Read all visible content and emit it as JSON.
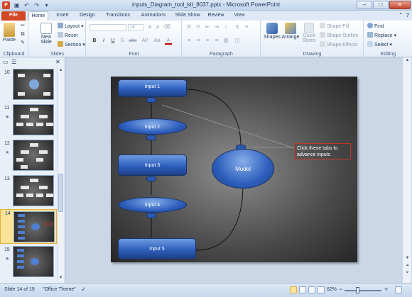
{
  "window": {
    "title": "inputs_Diagram_tool_kit_8037.pptx - Microsoft PowerPoint",
    "app_icon": "P"
  },
  "tabs": [
    "File",
    "Home",
    "Insert",
    "Design",
    "Transitions",
    "Animations",
    "Slide Show",
    "Review",
    "View"
  ],
  "ribbon": {
    "clipboard": {
      "paste": "Paste",
      "label": "Clipboard"
    },
    "slides": {
      "new_slide": "New",
      "new_slide2": "Slide",
      "layout": "Layout",
      "reset": "Reset",
      "section": "Section",
      "label": "Slides"
    },
    "font": {
      "size": "18",
      "label": "Font",
      "bold": "B",
      "italic": "I",
      "underline": "U",
      "strike": "S",
      "abc": "abc",
      "av": "AV",
      "aa": "Aa",
      "a": "A"
    },
    "paragraph": {
      "label": "Paragraph"
    },
    "drawing": {
      "shapes": "Shapes",
      "arrange": "Arrange",
      "quick_styles": "Quick",
      "quick_styles2": "Styles",
      "shape_fill": "Shape Fill",
      "shape_outline": "Shape Outline",
      "shape_effects": "Shape Effects",
      "label": "Drawing"
    },
    "editing": {
      "find": "Find",
      "replace": "Replace",
      "select": "Select",
      "label": "Editing"
    }
  },
  "slides_panel": {
    "items": [
      {
        "num": "10"
      },
      {
        "num": "11"
      },
      {
        "num": "12"
      },
      {
        "num": "13"
      },
      {
        "num": "14"
      },
      {
        "num": "15"
      }
    ]
  },
  "slide": {
    "inputs": [
      "Input 1",
      "Input 2",
      "Input 3",
      "Input 4",
      "Input 5"
    ],
    "model": "Model",
    "callout": "Click these tabs to advance inputs"
  },
  "status": {
    "slide_info": "Slide 14 of 19",
    "theme": "\"Office Theme\"",
    "zoom": "62%",
    "zoom_minus": "−",
    "zoom_plus": "+"
  },
  "colors": {
    "file_tab": "#d24726",
    "node_blue": "#2e5fbd",
    "callout_border": "#c0392b",
    "selected_thumb": "#fbe39a"
  }
}
